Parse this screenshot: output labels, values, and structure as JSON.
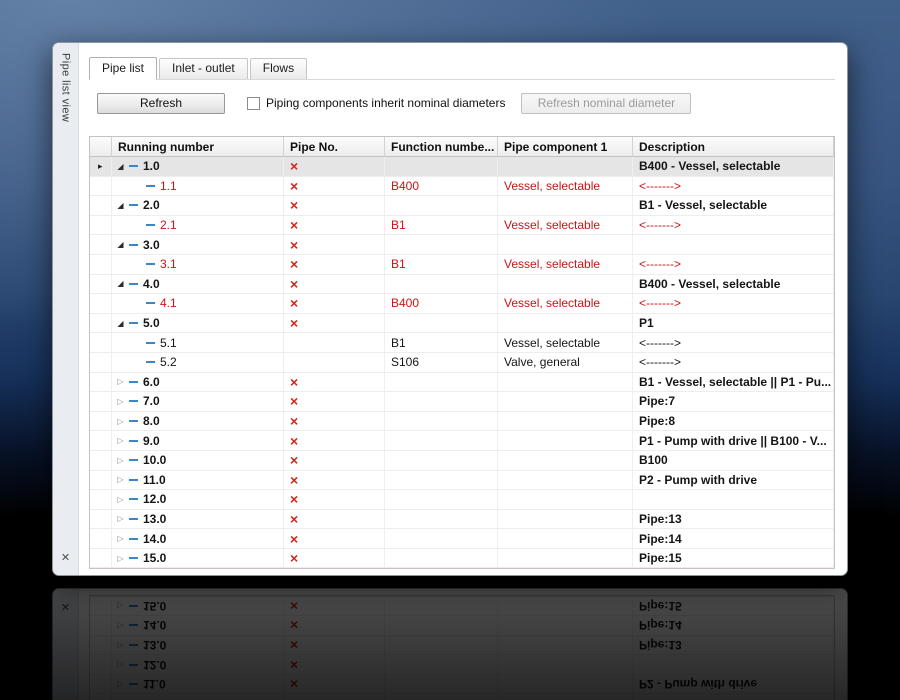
{
  "window": {
    "side_label": "Pipe list view"
  },
  "icons": {
    "close": "✕",
    "error_x": "×",
    "expanded": "◢",
    "collapsed": "▷",
    "row_indicator": "▸"
  },
  "colors": {
    "error_red": "#d3261b",
    "row_red": "#cc1414",
    "dash_blue": "#3a86c8"
  },
  "tabs": [
    {
      "label": "Pipe list",
      "active": true
    },
    {
      "label": "Inlet - outlet",
      "active": false
    },
    {
      "label": "Flows",
      "active": false
    }
  ],
  "toolbar": {
    "refresh_button": "Refresh",
    "checkbox_label": "Piping components inherit nominal diameters",
    "checkbox_checked": false,
    "refresh_nominal_button": "Refresh nominal diameter"
  },
  "table": {
    "columns": [
      "Running number",
      "Pipe No.",
      "Function numbe...",
      "Pipe component 1",
      "Description"
    ],
    "rows": [
      {
        "running": "1.0",
        "level": 0,
        "state": "expanded",
        "error": true,
        "function": "",
        "component": "",
        "description": "B400 - Vessel, selectable",
        "red": false,
        "selected": true
      },
      {
        "running": "1.1",
        "level": 1,
        "state": "leaf",
        "error": true,
        "function": "B400",
        "component": "Vessel, selectable",
        "description": "<------->",
        "red": true,
        "selected": false
      },
      {
        "running": "2.0",
        "level": 0,
        "state": "expanded",
        "error": true,
        "function": "",
        "component": "",
        "description": "B1 - Vessel, selectable",
        "red": false,
        "selected": false
      },
      {
        "running": "2.1",
        "level": 1,
        "state": "leaf",
        "error": true,
        "function": "B1",
        "component": "Vessel, selectable",
        "description": "<------->",
        "red": true,
        "selected": false
      },
      {
        "running": "3.0",
        "level": 0,
        "state": "expanded",
        "error": true,
        "function": "",
        "component": "",
        "description": "",
        "red": false,
        "selected": false
      },
      {
        "running": "3.1",
        "level": 1,
        "state": "leaf",
        "error": true,
        "function": "B1",
        "component": "Vessel, selectable",
        "description": "<------->",
        "red": true,
        "selected": false
      },
      {
        "running": "4.0",
        "level": 0,
        "state": "expanded",
        "error": true,
        "function": "",
        "component": "",
        "description": "B400 - Vessel, selectable",
        "red": false,
        "selected": false
      },
      {
        "running": "4.1",
        "level": 1,
        "state": "leaf",
        "error": true,
        "function": "B400",
        "component": "Vessel, selectable",
        "description": "<------->",
        "red": true,
        "selected": false
      },
      {
        "running": "5.0",
        "level": 0,
        "state": "expanded",
        "error": true,
        "function": "",
        "component": "",
        "description": "P1",
        "red": false,
        "selected": false
      },
      {
        "running": "5.1",
        "level": 1,
        "state": "leaf",
        "error": false,
        "function": "B1",
        "component": "Vessel, selectable",
        "description": "<------->",
        "red": false,
        "selected": false
      },
      {
        "running": "5.2",
        "level": 1,
        "state": "leaf",
        "error": false,
        "function": "S106",
        "component": "Valve, general",
        "description": "<------->",
        "red": false,
        "selected": false
      },
      {
        "running": "6.0",
        "level": 0,
        "state": "collapsed",
        "error": true,
        "function": "",
        "component": "",
        "description": "B1 - Vessel, selectable || P1 - Pu...",
        "red": false,
        "selected": false
      },
      {
        "running": "7.0",
        "level": 0,
        "state": "collapsed",
        "error": true,
        "function": "",
        "component": "",
        "description": "Pipe:7",
        "red": false,
        "selected": false
      },
      {
        "running": "8.0",
        "level": 0,
        "state": "collapsed",
        "error": true,
        "function": "",
        "component": "",
        "description": "Pipe:8",
        "red": false,
        "selected": false
      },
      {
        "running": "9.0",
        "level": 0,
        "state": "collapsed",
        "error": true,
        "function": "",
        "component": "",
        "description": "P1 - Pump with drive || B100 - V...",
        "red": false,
        "selected": false
      },
      {
        "running": "10.0",
        "level": 0,
        "state": "collapsed",
        "error": true,
        "function": "",
        "component": "",
        "description": "B100",
        "red": false,
        "selected": false
      },
      {
        "running": "11.0",
        "level": 0,
        "state": "collapsed",
        "error": true,
        "function": "",
        "component": "",
        "description": "P2 - Pump with drive",
        "red": false,
        "selected": false
      },
      {
        "running": "12.0",
        "level": 0,
        "state": "collapsed",
        "error": true,
        "function": "",
        "component": "",
        "description": "",
        "red": false,
        "selected": false
      },
      {
        "running": "13.0",
        "level": 0,
        "state": "collapsed",
        "error": true,
        "function": "",
        "component": "",
        "description": "Pipe:13",
        "red": false,
        "selected": false
      },
      {
        "running": "14.0",
        "level": 0,
        "state": "collapsed",
        "error": true,
        "function": "",
        "component": "",
        "description": "Pipe:14",
        "red": false,
        "selected": false
      },
      {
        "running": "15.0",
        "level": 0,
        "state": "collapsed",
        "error": true,
        "function": "",
        "component": "",
        "description": "Pipe:15",
        "red": false,
        "selected": false
      }
    ]
  }
}
